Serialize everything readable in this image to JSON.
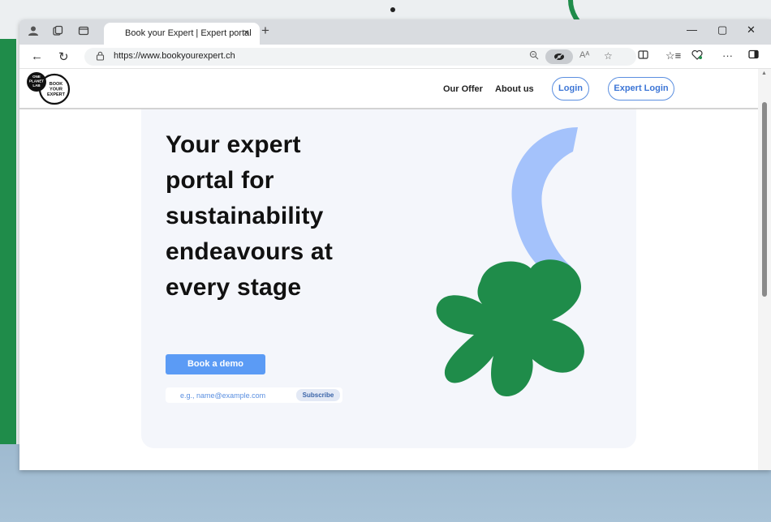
{
  "browser": {
    "tab_title": "Book your Expert | Expert portal",
    "tab_close": "×",
    "new_tab": "+",
    "url": "https://www.bookyourexpert.ch",
    "window_controls": {
      "minimize": "—",
      "maximize": "▢",
      "close": "✕"
    },
    "reader_mode": "Aᴬ"
  },
  "site": {
    "logo_text": [
      "ONE",
      "PLANET",
      "LAB",
      "BOOK",
      "YOUR",
      "EXPERT"
    ],
    "nav": {
      "our_offer": "Our Offer",
      "about_us": "About us",
      "login": "Login",
      "expert_login": "Expert Login"
    }
  },
  "hero": {
    "headline_lines": [
      "Your expert",
      "portal for",
      "sustainability",
      "endeavours at",
      "every stage"
    ],
    "demo_button": "Book a demo",
    "email_placeholder": "e.g., name@example.com",
    "subscribe_button": "Subscribe"
  },
  "colors": {
    "accent": "#5b9bf5",
    "brand_green": "#1f8c4a",
    "shape_blue": "#a4c2fb"
  }
}
